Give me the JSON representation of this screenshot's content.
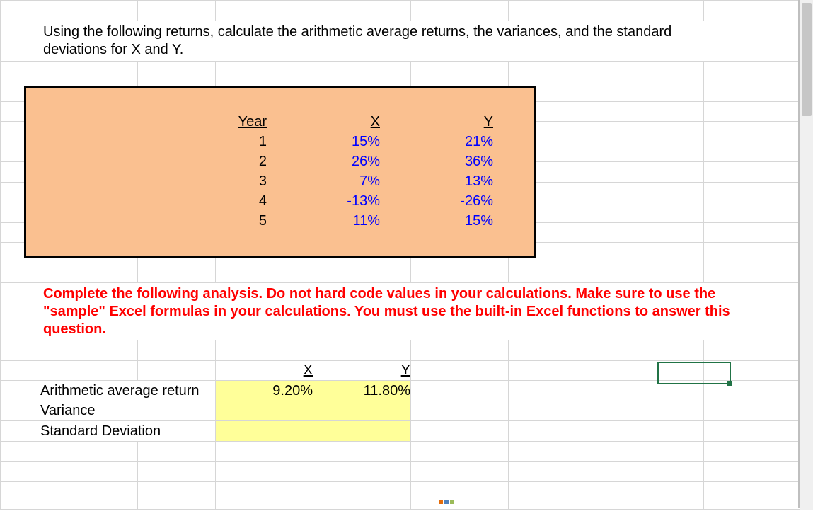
{
  "question": "Using the following returns, calculate the arithmetic average returns, the variances, and the standard deviations for X and Y.",
  "data_table": {
    "headers": {
      "year": "Year",
      "x": "X",
      "y": "Y"
    },
    "rows": [
      {
        "year": "1",
        "x": "15%",
        "y": "21%"
      },
      {
        "year": "2",
        "x": "26%",
        "y": "36%"
      },
      {
        "year": "3",
        "x": "7%",
        "y": "13%"
      },
      {
        "year": "4",
        "x": "-13%",
        "y": "-26%"
      },
      {
        "year": "5",
        "x": "11%",
        "y": "15%"
      }
    ]
  },
  "instructions": "Complete the following analysis. Do not hard code values in your calculations. Make sure to use the \"sample\" Excel formulas in your calculations. You must use the built-in Excel functions to answer this question.",
  "results": {
    "headers": {
      "x": "X",
      "y": "Y"
    },
    "rows": [
      {
        "label": "Arithmetic average return",
        "x": "9.20%",
        "y": "11.80%"
      },
      {
        "label": "Variance",
        "x": "",
        "y": ""
      },
      {
        "label": "Standard Deviation",
        "x": "",
        "y": ""
      }
    ]
  }
}
